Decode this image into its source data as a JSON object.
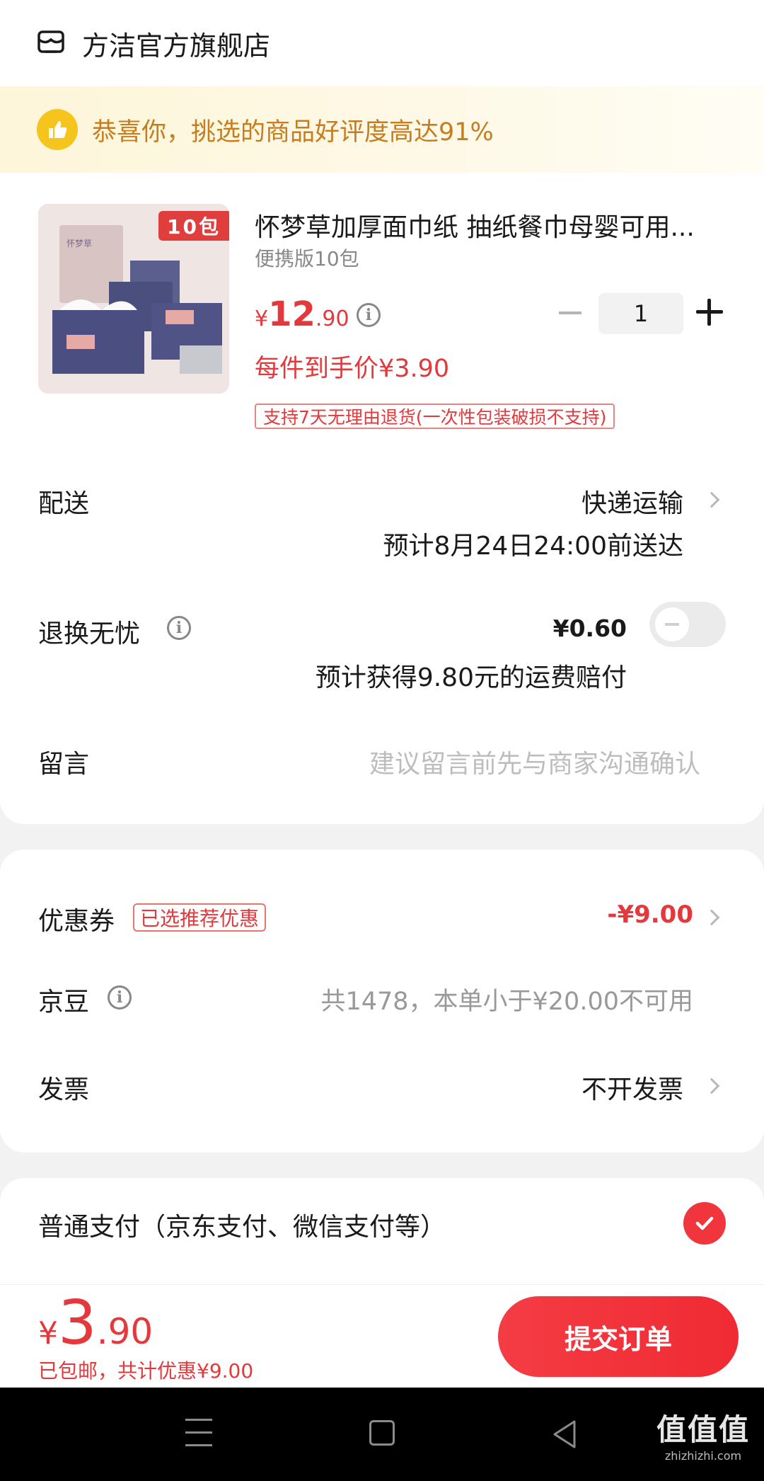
{
  "store": {
    "name": "方洁官方旗舰店",
    "icon": "store-icon"
  },
  "banner": {
    "text": "恭喜你，挑选的商品好评度高达91%",
    "icon": "thumbs-up-icon"
  },
  "product": {
    "image_tag": "10包",
    "title": "怀梦草加厚面巾纸 抽纸餐巾母婴可用...",
    "spec": "便携版10包",
    "price_yen": "¥",
    "price_int": "12",
    "price_dec": ".90",
    "unit_price": "每件到手价¥3.90",
    "quantity": "1",
    "return_policy": "支持7天无理由退货(一次性包装破损不支持)"
  },
  "delivery": {
    "label": "配送",
    "method": "快递运输",
    "eta": "预计8月24日24:00前送达"
  },
  "insurance": {
    "label": "退换无忧",
    "price": "¥0.60",
    "compensation": "预计获得9.80元的运费赔付",
    "enabled": false
  },
  "note": {
    "label": "留言",
    "placeholder": "建议留言前先与商家沟通确认"
  },
  "coupon": {
    "label": "优惠券",
    "tag": "已选推荐优惠",
    "value": "-¥9.00"
  },
  "beans": {
    "label": "京豆",
    "text": "共1478，本单小于¥20.00不可用"
  },
  "invoice": {
    "label": "发票",
    "value": "不开发票"
  },
  "payment": {
    "label": "普通支付（京东支付、微信支付等）",
    "selected": true
  },
  "footer": {
    "total_yen": "¥",
    "total_int": "3",
    "total_dec": ".90",
    "sub": "已包邮，共计优惠¥9.00",
    "submit": "提交订单"
  },
  "watermark": {
    "big": "值值值",
    "small": "zhizhizhi.com"
  },
  "colors": {
    "accent": "#e4393c",
    "banner_text": "#c77c1e",
    "banner_bg": "#fdf6da"
  }
}
